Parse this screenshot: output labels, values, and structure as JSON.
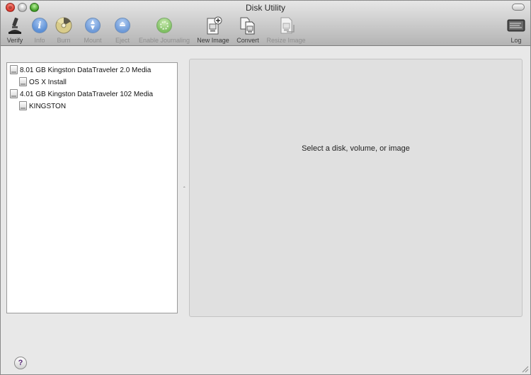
{
  "window": {
    "title": "Disk Utility"
  },
  "toolbar": {
    "items": [
      {
        "label": "Verify",
        "icon": "microscope-icon",
        "enabled": true
      },
      {
        "label": "Info",
        "icon": "info-icon",
        "enabled": false
      },
      {
        "label": "Burn",
        "icon": "burn-icon",
        "enabled": false
      },
      {
        "label": "Mount",
        "icon": "mount-icon",
        "enabled": false
      },
      {
        "label": "Eject",
        "icon": "eject-icon",
        "enabled": false
      },
      {
        "label": "Enable Journaling",
        "icon": "journaling-icon",
        "enabled": false
      },
      {
        "label": "New Image",
        "icon": "new-image-icon",
        "enabled": true
      },
      {
        "label": "Convert",
        "icon": "convert-icon",
        "enabled": true
      },
      {
        "label": "Resize Image",
        "icon": "resize-image-icon",
        "enabled": false
      }
    ],
    "log": {
      "label": "Log",
      "icon": "log-icon"
    }
  },
  "sidebar": {
    "items": [
      {
        "label": "8.01 GB Kingston DataTraveler 2.0 Media",
        "level": 0
      },
      {
        "label": "OS X Install",
        "level": 1
      },
      {
        "label": "4.01 GB Kingston DataTraveler 102 Media",
        "level": 0
      },
      {
        "label": "KINGSTON",
        "level": 1
      }
    ]
  },
  "detail": {
    "message": "Select a disk, volume, or image"
  },
  "help": {
    "label": "?"
  },
  "colors": {
    "accent_purple": "#5a2a7a",
    "blue_button": "#5b8fd6",
    "green_button": "#3c9b21"
  }
}
